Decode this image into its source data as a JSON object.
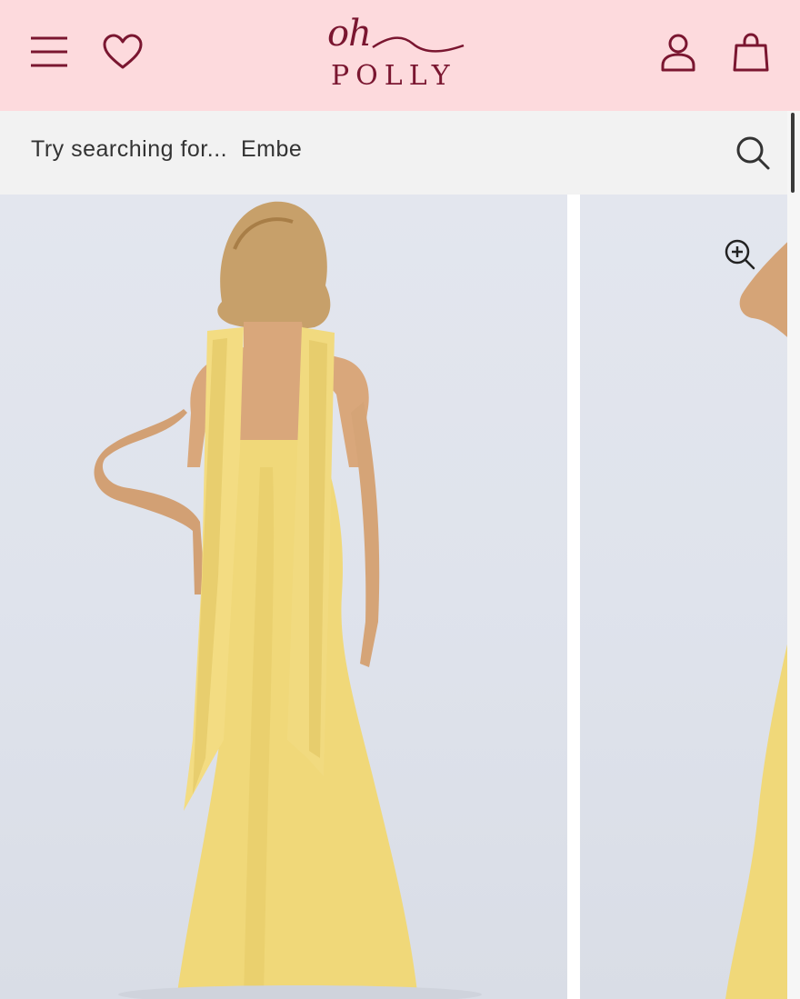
{
  "header": {
    "logo_script": "oh",
    "logo_word": "POLLY",
    "icons": [
      "menu-icon",
      "heart-icon",
      "account-icon",
      "bag-icon"
    ],
    "background": "#fddadd",
    "brand_color": "#7a1630"
  },
  "search": {
    "prompt": "Try searching for...",
    "suggestion": "Embe"
  },
  "gallery": {
    "images": [
      "back view of yellow maxi dress with draped halter scarf",
      "second product image"
    ],
    "dress_color": "#f0d879"
  }
}
